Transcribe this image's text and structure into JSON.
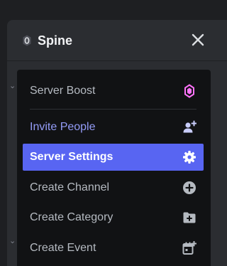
{
  "server": {
    "name": "Spine"
  },
  "menu": {
    "items": [
      {
        "label": "Server Boost",
        "icon": "boost-gem-icon"
      },
      {
        "label": "Invite People",
        "icon": "add-person-icon"
      },
      {
        "label": "Server Settings",
        "icon": "gear-icon"
      },
      {
        "label": "Create Channel",
        "icon": "plus-circle-icon"
      },
      {
        "label": "Create Category",
        "icon": "folder-plus-icon"
      },
      {
        "label": "Create Event",
        "icon": "calendar-plus-icon"
      }
    ]
  },
  "colors": {
    "accent": "#5865f2",
    "invite_text": "#949cf7",
    "boost_pink": "#ff73fa",
    "menu_bg": "#111214",
    "panel_bg": "#2b2d31"
  }
}
